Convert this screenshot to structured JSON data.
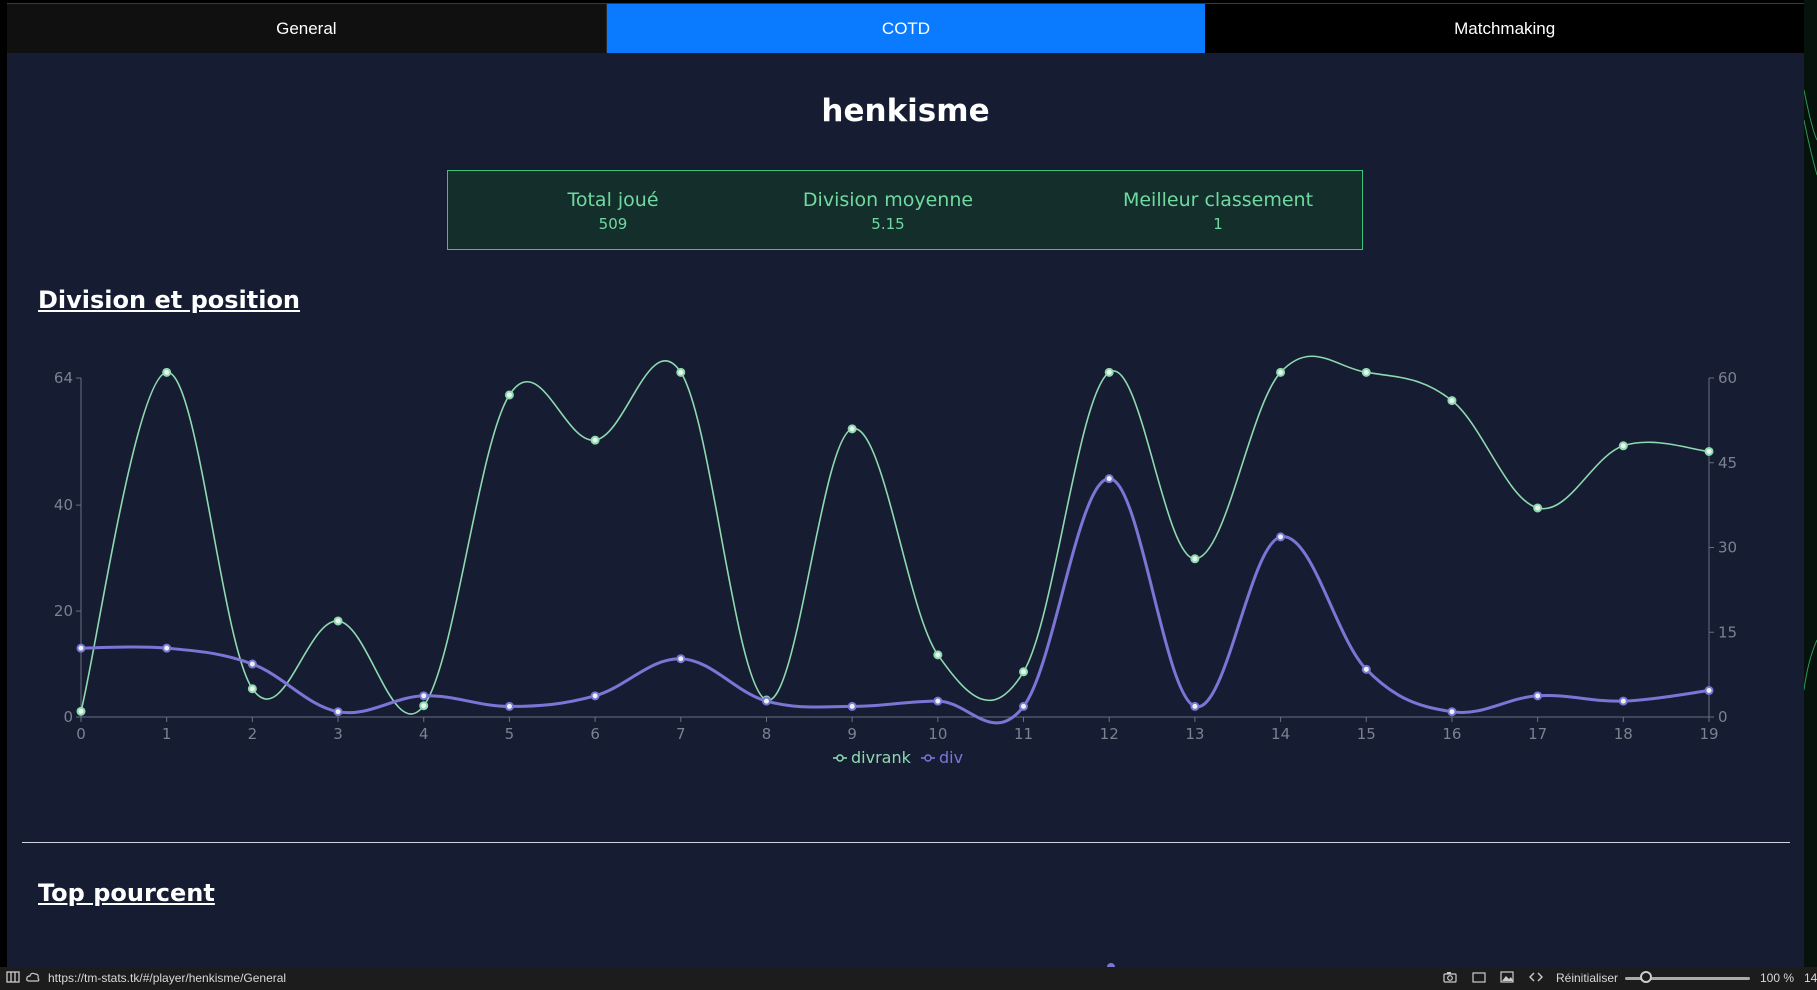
{
  "tabs": [
    {
      "label": "General"
    },
    {
      "label": "COTD"
    },
    {
      "label": "Matchmaking"
    }
  ],
  "active_tab": "COTD",
  "player": {
    "name": "henkisme"
  },
  "stats": [
    {
      "label": "Total joué",
      "value": "509"
    },
    {
      "label": "Division moyenne",
      "value": "5.15"
    },
    {
      "label": "Meilleur classement",
      "value": "1"
    }
  ],
  "sections": {
    "division_title": "Division et position",
    "top_title": "Top pourcent"
  },
  "chart_data": {
    "type": "line",
    "x": [
      0,
      1,
      2,
      3,
      4,
      5,
      6,
      7,
      8,
      9,
      10,
      11,
      12,
      13,
      14,
      15,
      16,
      17,
      18,
      19
    ],
    "x_ticks": [
      "0",
      "1",
      "2",
      "3",
      "4",
      "5",
      "6",
      "7",
      "8",
      "9",
      "10",
      "11",
      "12",
      "13",
      "14",
      "15",
      "16",
      "17",
      "18",
      "19"
    ],
    "y_left": {
      "ticks": [
        "0",
        "20",
        "40",
        "64"
      ],
      "tick_values": [
        0,
        20,
        40,
        64
      ],
      "range": [
        0,
        64
      ]
    },
    "y_right": {
      "ticks": [
        "0",
        "15",
        "30",
        "45",
        "60"
      ],
      "tick_values": [
        0,
        15,
        30,
        45,
        60
      ],
      "range": [
        0,
        60
      ]
    },
    "grid": false,
    "legend": "bottom-center",
    "series": [
      {
        "name": "divrank",
        "axis": "right",
        "color": "#8fd9b0",
        "values": [
          1,
          61,
          5,
          17,
          2,
          57,
          49,
          61,
          3,
          51,
          11,
          8,
          61,
          28,
          61,
          61,
          56,
          37,
          48,
          47
        ]
      },
      {
        "name": "div",
        "axis": "left",
        "color": "#7b76d6",
        "values": [
          13,
          13,
          10,
          1,
          4,
          2,
          4,
          11,
          3,
          2,
          3,
          2,
          45,
          2,
          34,
          9,
          1,
          4,
          3,
          5
        ]
      }
    ]
  },
  "statusbar": {
    "url": "https://tm-stats.tk/#/player/henkisme/General",
    "reset_label": "Réinitialiser",
    "zoom": "100 %",
    "extra": "14"
  },
  "colors": {
    "background": "#161d33",
    "active_tab": "#0a7bff",
    "stat_border": "#3ec27a",
    "stat_text": "#6fd9a0"
  }
}
